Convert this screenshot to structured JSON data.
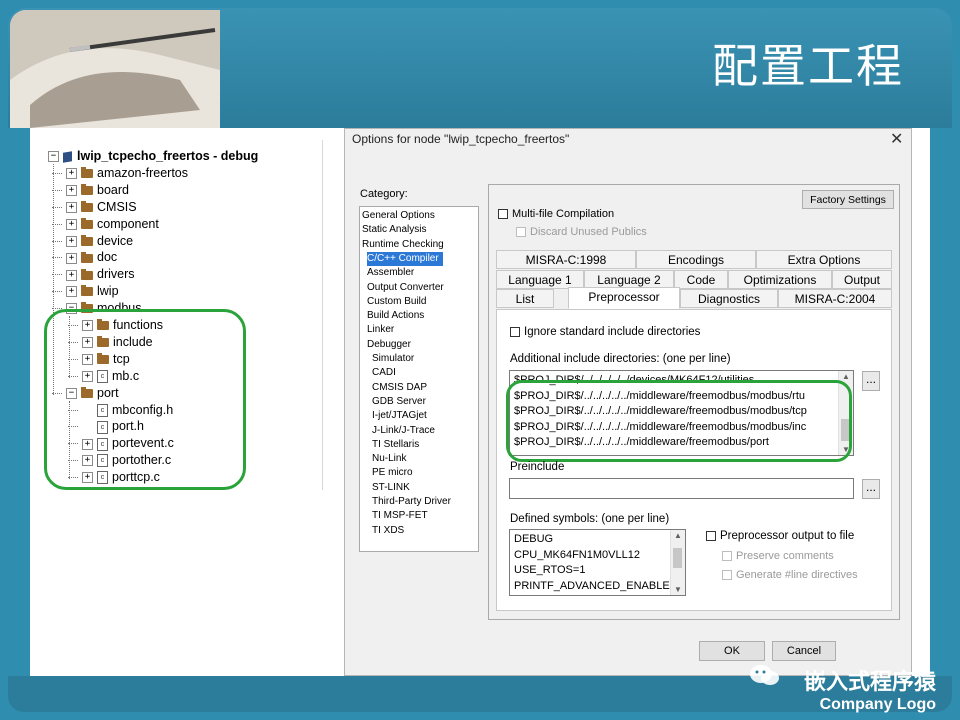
{
  "slide": {
    "title": "配置工程",
    "logo_cn": "嵌入式程序猿",
    "logo_en": "Company Logo"
  },
  "tree": {
    "root": "lwip_tcpecho_freertos - debug",
    "items": [
      {
        "label": "amazon-freertos",
        "type": "folder",
        "exp": "+"
      },
      {
        "label": "board",
        "type": "folder",
        "exp": "+"
      },
      {
        "label": "CMSIS",
        "type": "folder",
        "exp": "+"
      },
      {
        "label": "component",
        "type": "folder",
        "exp": "+"
      },
      {
        "label": "device",
        "type": "folder",
        "exp": "+"
      },
      {
        "label": "doc",
        "type": "folder",
        "exp": "+"
      },
      {
        "label": "drivers",
        "type": "folder",
        "exp": "+"
      },
      {
        "label": "lwip",
        "type": "folder",
        "exp": "+"
      },
      {
        "label": "modbus",
        "type": "folder",
        "exp": "-"
      },
      {
        "label": "functions",
        "type": "folder",
        "exp": "+"
      },
      {
        "label": "include",
        "type": "folder",
        "exp": "+"
      },
      {
        "label": "tcp",
        "type": "folder",
        "exp": "+"
      },
      {
        "label": "mb.c",
        "type": "file",
        "exp": "+"
      },
      {
        "label": "port",
        "type": "folder",
        "exp": "-"
      },
      {
        "label": "mbconfig.h",
        "type": "file",
        "exp": ""
      },
      {
        "label": "port.h",
        "type": "file",
        "exp": ""
      },
      {
        "label": "portevent.c",
        "type": "file",
        "exp": "+"
      },
      {
        "label": "portother.c",
        "type": "file",
        "exp": "+"
      },
      {
        "label": "porttcp.c",
        "type": "file",
        "exp": "+"
      }
    ]
  },
  "dialog": {
    "title": "Options for node \"lwip_tcpecho_freertos\"",
    "close": "✕",
    "category_label": "Category:",
    "categories": [
      "General Options",
      "Static Analysis",
      "Runtime Checking",
      "C/C++ Compiler",
      "Assembler",
      "Output Converter",
      "Custom Build",
      "Build Actions",
      "Linker",
      "Debugger",
      "Simulator",
      "CADI",
      "CMSIS DAP",
      "GDB Server",
      "I-jet/JTAGjet",
      "J-Link/J-Trace",
      "TI Stellaris",
      "Nu-Link",
      "PE micro",
      "ST-LINK",
      "Third-Party Driver",
      "TI MSP-FET",
      "TI XDS"
    ],
    "factory_settings": "Factory Settings",
    "multifile": "Multi-file Compilation",
    "discard": "Discard Unused Publics",
    "tabs_row1": [
      "MISRA-C:1998",
      "Encodings",
      "Extra Options"
    ],
    "tabs_row2": [
      "Language 1",
      "Language 2",
      "Code",
      "Optimizations",
      "Output"
    ],
    "tabs_row3": [
      "List",
      "Preprocessor",
      "Diagnostics",
      "MISRA-C:2004"
    ],
    "ignore_std": "Ignore standard include directories",
    "additional_label": "Additional include directories: (one per line)",
    "include_dirs": [
      "$PROJ_DIR$/../../../../../devices/MK64F12/utilities",
      "$PROJ_DIR$/../../../../../middleware/freemodbus/modbus/rtu",
      "$PROJ_DIR$/../../../../../middleware/freemodbus/modbus/tcp",
      "$PROJ_DIR$/../../../../../middleware/freemodbus/modbus/inc",
      "$PROJ_DIR$/../../../../../middleware/freemodbus/port"
    ],
    "browse": "...",
    "preinclude_label": "Preinclude",
    "defined_label": "Defined symbols: (one per line)",
    "symbols": [
      "DEBUG",
      "CPU_MK64FN1M0VLL12",
      "USE_RTOS=1",
      "PRINTF_ADVANCED_ENABLE="
    ],
    "pp_output": "Preprocessor output to file",
    "preserve": "Preserve comments",
    "generate": "Generate #line directives",
    "ok": "OK",
    "cancel": "Cancel"
  }
}
